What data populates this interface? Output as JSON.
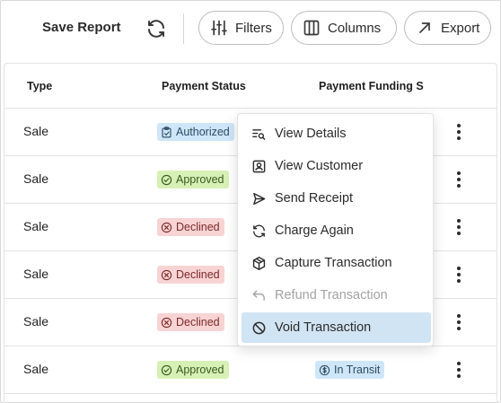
{
  "toolbar": {
    "save_report": "Save Report",
    "refresh_icon": "refresh-icon",
    "filters_label": "Filters",
    "columns_label": "Columns",
    "export_label": "Export"
  },
  "table": {
    "headers": {
      "type": "Type",
      "payment_status": "Payment Status",
      "payment_funding": "Payment Funding S"
    },
    "rows": [
      {
        "type": "Sale",
        "status": "Authorized",
        "status_kind": "authorized",
        "funding": ""
      },
      {
        "type": "Sale",
        "status": "Approved",
        "status_kind": "approved",
        "funding": ""
      },
      {
        "type": "Sale",
        "status": "Declined",
        "status_kind": "declined",
        "funding": ""
      },
      {
        "type": "Sale",
        "status": "Declined",
        "status_kind": "declined",
        "funding": ""
      },
      {
        "type": "Sale",
        "status": "Declined",
        "status_kind": "declined",
        "funding": ""
      },
      {
        "type": "Sale",
        "status": "Approved",
        "status_kind": "approved",
        "funding": "In Transit"
      }
    ]
  },
  "context_menu": {
    "items": [
      {
        "label": "View Details",
        "icon": "list-search-icon",
        "disabled": false,
        "active": false
      },
      {
        "label": "View Customer",
        "icon": "user-card-icon",
        "disabled": false,
        "active": false
      },
      {
        "label": "Send Receipt",
        "icon": "send-icon",
        "disabled": false,
        "active": false
      },
      {
        "label": "Charge Again",
        "icon": "refresh-icon",
        "disabled": false,
        "active": false
      },
      {
        "label": "Capture Transaction",
        "icon": "package-icon",
        "disabled": false,
        "active": false
      },
      {
        "label": "Refund Transaction",
        "icon": "undo-arrow-icon",
        "disabled": true,
        "active": false
      },
      {
        "label": "Void Transaction",
        "icon": "ban-icon",
        "disabled": false,
        "active": true
      }
    ]
  },
  "colors": {
    "authorized_bg": "#cfe6f8",
    "approved_bg": "#d7f0b5",
    "declined_bg": "#f8d3d3",
    "menu_active_bg": "#d1e4f3"
  }
}
